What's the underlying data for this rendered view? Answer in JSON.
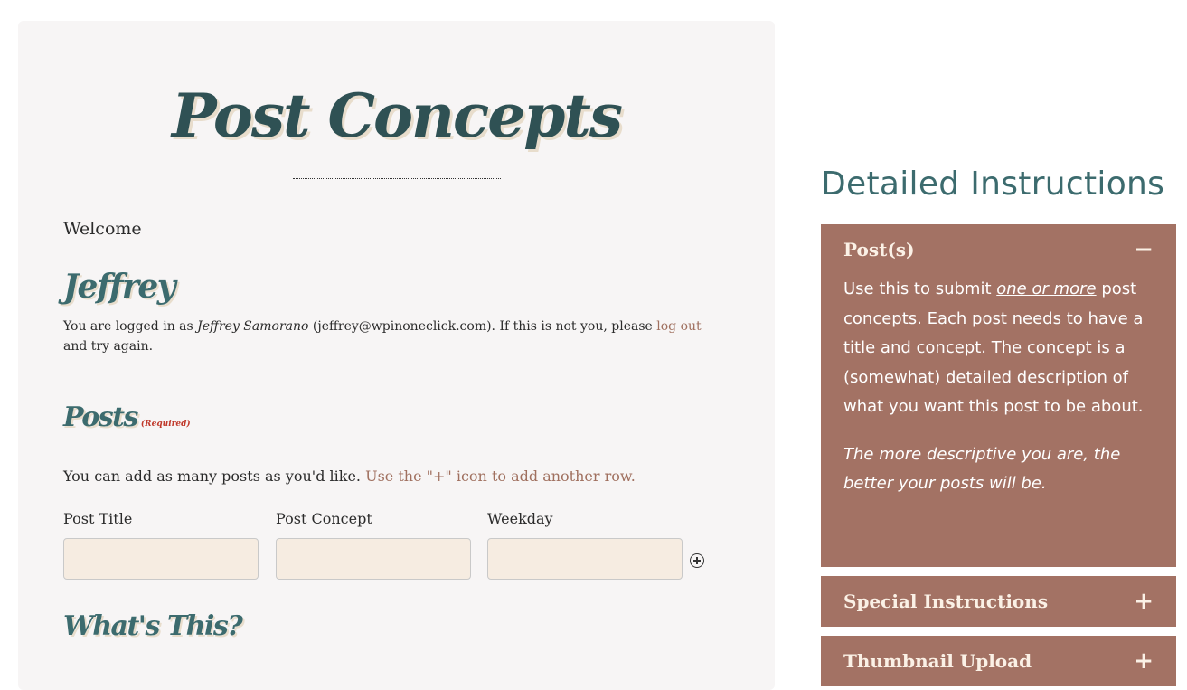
{
  "form": {
    "title": "Post Concepts",
    "welcome": "Welcome",
    "user_name": "Jeffrey",
    "login_note": {
      "prefix": "You are logged in as ",
      "full_name": "Jeffrey Samorano",
      "email_part": " (jeffrey@wpinoneclick.com). If this is not you, please ",
      "logout_link": "log out",
      "suffix": " and try again."
    },
    "posts_heading": "Posts",
    "required_tag": "(Required)",
    "posts_desc": "You can add as many posts as you'd like. ",
    "posts_hint": "Use the \"+\" icon to add another row.",
    "fields": {
      "post_title_label": "Post Title",
      "post_concept_label": "Post Concept",
      "weekday_label": "Weekday",
      "post_title_value": "",
      "post_concept_value": "",
      "weekday_value": ""
    },
    "whats_this_heading": "What's This?"
  },
  "sidebar": {
    "title": "Detailed Instructions",
    "accordion": [
      {
        "label": "Post(s)",
        "toggle": "−",
        "expanded": true,
        "body_p1_a": "Use this to submit ",
        "body_p1_emph": "one or more",
        "body_p1_b": " post concepts. Each post needs to have a title and concept. The concept is a (somewhat) detailed description of what you want this post to be about.",
        "body_p2": "The more descriptive you are, the better your posts will be."
      },
      {
        "label": "Special Instructions",
        "toggle": "+",
        "expanded": false
      },
      {
        "label": "Thumbnail Upload",
        "toggle": "+",
        "expanded": false
      }
    ]
  },
  "colors": {
    "heading_teal": "#3c6b6e",
    "accordion_bg": "#a37264",
    "link_brown": "#a0705f",
    "input_bg": "#f6ece1",
    "card_bg": "#f7f5f5"
  },
  "icons": {
    "add_row": "plus-circle-icon",
    "collapse": "minus-icon",
    "expand": "plus-icon"
  }
}
